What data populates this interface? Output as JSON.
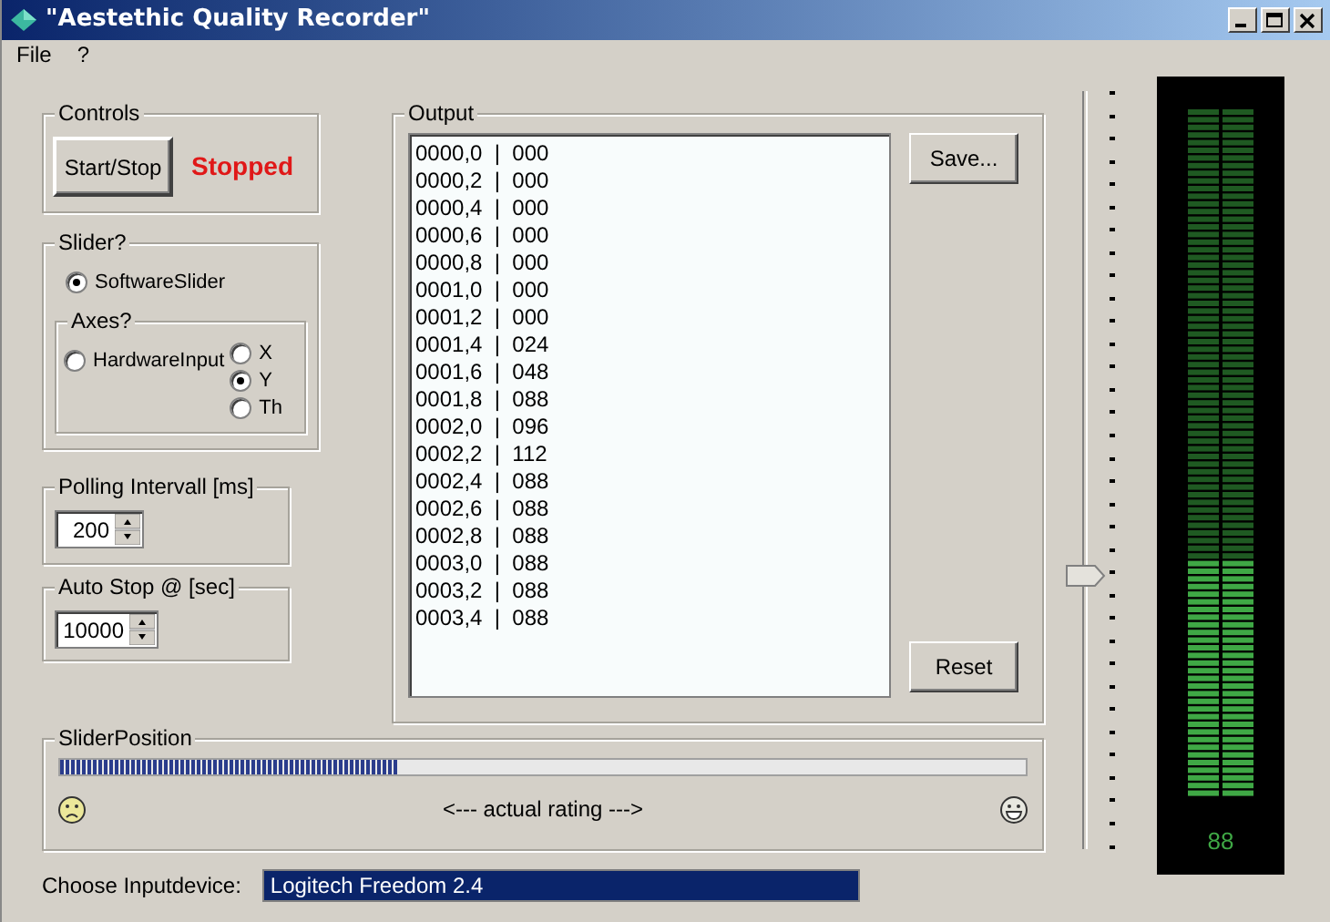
{
  "window": {
    "title": "\"Aestethic Quality Recorder\""
  },
  "menu": [
    "File",
    "?"
  ],
  "controls": {
    "title": "Controls",
    "button": "Start/Stop",
    "status": "Stopped"
  },
  "slider_group": {
    "title": "Slider?",
    "software": {
      "label": "SoftwareSlider",
      "selected": true
    },
    "axes": {
      "title": "Axes?",
      "hardware": {
        "label": "HardwareInput",
        "selected": false
      },
      "options": [
        {
          "label": "X",
          "selected": false
        },
        {
          "label": "Y",
          "selected": true
        },
        {
          "label": "Th",
          "selected": false
        }
      ]
    }
  },
  "polling": {
    "title": "Polling Intervall [ms]",
    "value": "200"
  },
  "auto_stop": {
    "title": "Auto Stop @ [sec]",
    "value": "10000"
  },
  "output": {
    "title": "Output",
    "lines": [
      "0000,0  |  000",
      "0000,2  |  000",
      "0000,4  |  000",
      "0000,6  |  000",
      "0000,8  |  000",
      "0001,0  |  000",
      "0001,2  |  000",
      "0001,4  |  024",
      "0001,6  |  048",
      "0001,8  |  088",
      "0002,0  |  096",
      "0002,2  |  112",
      "0002,4  |  088",
      "0002,6  |  088",
      "0002,8  |  088",
      "0003,0  |  088",
      "0003,2  |  088",
      "0003,4  |  088"
    ],
    "save_button": "Save...",
    "reset_button": "Reset"
  },
  "slider_position": {
    "title": "SliderPosition",
    "level": 0.35,
    "caption": "<--- actual rating --->"
  },
  "input_device": {
    "label": "Choose Inputdevice:",
    "value": "Logitech Freedom 2.4"
  },
  "rating_slider": {
    "level": 0.36
  },
  "meter": {
    "level": 0.34,
    "reading": "88"
  }
}
